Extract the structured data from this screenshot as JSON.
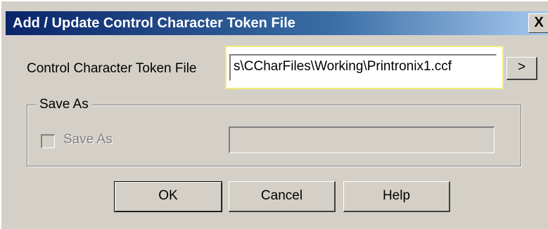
{
  "window": {
    "title": "Add / Update Control Character Token File",
    "close_label": "X"
  },
  "token_file": {
    "label": "Control Character Token File",
    "value": "s\\CCharFiles\\Working\\Printronix1.ccf",
    "browse_label": ">"
  },
  "save_as_group": {
    "legend": "Save As",
    "checkbox_label": "Save As",
    "checkbox_checked": false,
    "input_value": ""
  },
  "buttons": {
    "ok": "OK",
    "cancel": "Cancel",
    "help": "Help"
  },
  "colors": {
    "titlebar_start": "#0a246a",
    "titlebar_end": "#a6caf0",
    "highlight_border": "#f3ec7a",
    "dialog_face": "#d4d0c8"
  }
}
